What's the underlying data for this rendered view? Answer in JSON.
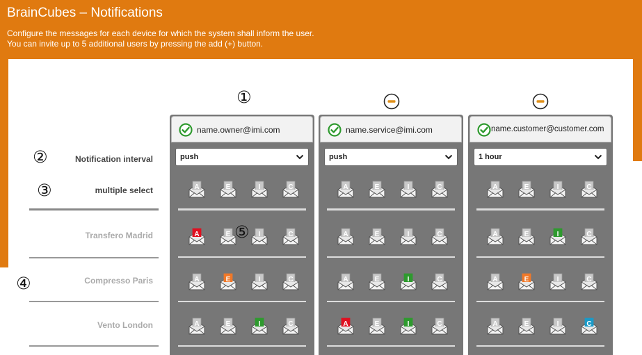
{
  "header": {
    "title": "BrainCubes – Notifications",
    "line1": "Configure the messages for each device for which the system shall inform the user.",
    "line2": "You can invite up to 5 additional users by pressing the add (+) button."
  },
  "markers": {
    "m1": "①",
    "m2": "②",
    "m3": "③",
    "m4": "④",
    "m5": "⑤"
  },
  "labels": {
    "interval": "Notification interval",
    "multiple": "multiple select",
    "devices": [
      "Transfero Madrid",
      "Compresso Paris",
      "Vento London"
    ]
  },
  "users": [
    {
      "email": "name.owner@imi.com",
      "interval": "push"
    },
    {
      "email": "name.service@imi.com",
      "interval": "push"
    },
    {
      "email": "name.customer@customer.com",
      "interval": "1 hour"
    }
  ],
  "message_types": [
    "A",
    "E",
    "I",
    "C"
  ],
  "active_states": [
    [
      [
        "A"
      ],
      [],
      [
        "I"
      ]
    ],
    [
      [
        "E"
      ],
      [
        "I"
      ],
      [
        "E"
      ]
    ],
    [
      [
        "I"
      ],
      [
        "A",
        "I"
      ],
      [
        "C"
      ]
    ]
  ],
  "colors": {
    "header_bg": "#e07a10",
    "column_bg": "#777777",
    "A": "#e01020",
    "E": "#f07828",
    "I": "#2e9a2e",
    "C": "#1a9ac8",
    "inactive": "#c8c8c8",
    "remove_button": "#e0901a",
    "check": "#2e9a2e"
  },
  "icons": {
    "remove_user": "minus-circle-icon",
    "verified": "check-circle-icon",
    "dropdown": "chevron-down-icon",
    "message": "envelope-icon"
  }
}
